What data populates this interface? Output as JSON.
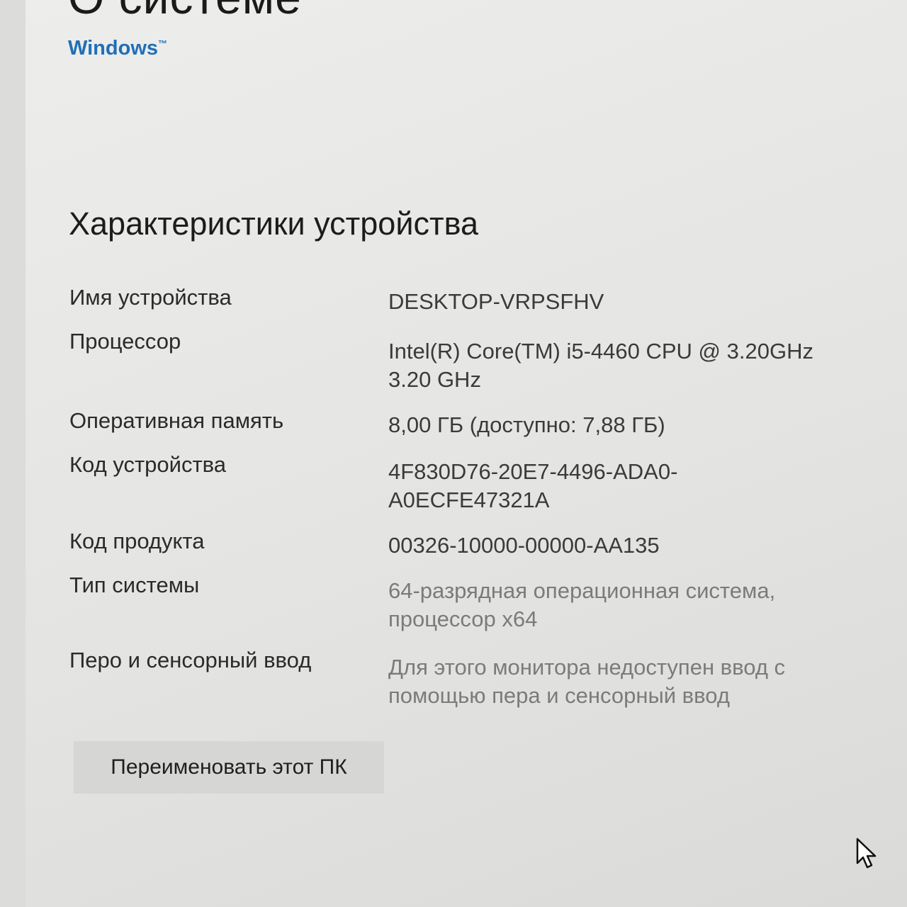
{
  "header": {
    "page_title": "О системе",
    "brand": "Windows",
    "brand_mark": "™"
  },
  "specs": {
    "section_title": "Характеристики устройства",
    "rows": [
      {
        "label": "Имя устройства",
        "value": "DESKTOP-VRPSFHV"
      },
      {
        "label": "Процессор",
        "value": "Intel(R) Core(TM) i5-4460  CPU @ 3.20GHz\n3.20 GHz"
      },
      {
        "label": "Оперативная память",
        "value": "8,00 ГБ (доступно: 7,88 ГБ)"
      },
      {
        "label": "Код устройства",
        "value": "4F830D76-20E7-4496-ADA0-\nA0ECFE47321A"
      },
      {
        "label": "Код продукта",
        "value": "00326-10000-00000-AA135"
      },
      {
        "label": "Тип системы",
        "value": "64-разрядная операционная система,\nпроцессор x64"
      },
      {
        "label": "Перо и сенсорный ввод",
        "value": "Для этого монитора недоступен ввод с\nпомощью пера и сенсорный ввод"
      }
    ]
  },
  "actions": {
    "rename_label": "Переименовать этот ПК"
  },
  "colors": {
    "accent": "#1f6fb8",
    "background": "#e9e9e7",
    "button": "#d6d6d4"
  },
  "icons": {
    "cursor": "mouse-pointer-icon"
  }
}
